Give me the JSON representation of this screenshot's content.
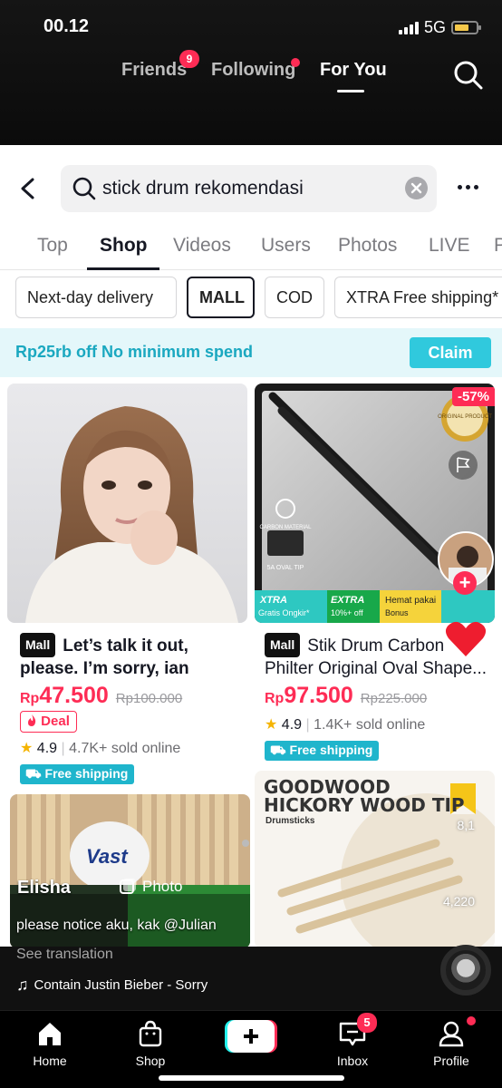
{
  "status_bar": {
    "time": "00.12",
    "network": "5G"
  },
  "tiktok_nav": {
    "friends": {
      "label": "Friends",
      "badge": "9"
    },
    "following": {
      "label": "Following"
    },
    "for_you": {
      "label": "For You"
    }
  },
  "search": {
    "query": "stick drum rekomendasi"
  },
  "tabs": [
    "Top",
    "Shop",
    "Videos",
    "Users",
    "Photos",
    "LIVE",
    "P"
  ],
  "active_tab": "Shop",
  "filters": [
    "Next-day delivery",
    "MALL",
    "COD",
    "XTRA Free shipping*"
  ],
  "selected_filter": "MALL",
  "promo": {
    "text": "Rp25rb off No minimum spend",
    "button": "Claim"
  },
  "products": [
    {
      "tag": "Mall",
      "title": "Let’s talk it out, please. I’m sorry, ian",
      "currency": "Rp",
      "price": "47.500",
      "original_price": "Rp100.000",
      "deal": "Deal",
      "rating": "4.9",
      "sold": "4.7K+ sold online",
      "shipping": "Free shipping"
    },
    {
      "tag": "Mall",
      "title": "Stik Drum Carbon Philter Original Oval Shape...",
      "currency": "Rp",
      "price": "97.500",
      "original_price": "Rp225.000",
      "discount": "-57%",
      "rating": "4.9",
      "sold": "1.4K+ sold online",
      "shipping": "Free shipping",
      "image_badges": {
        "original": "ORIGINAL PRODUCT",
        "carbon": "CARBON MATERIAL",
        "oval": "5A OVAL TIP",
        "xtra": "XTRA",
        "xtra_sub": "Gratis Ongkir*",
        "extra": "EXTRA",
        "extra_sub": "10%+ off",
        "hemat": "Hemat pakai",
        "hemat_sub": "Bonus"
      }
    }
  ],
  "media_cards": [
    {
      "brand": "Vast",
      "author": "Elisha",
      "type": "Photo"
    },
    {
      "headline": "GOODWOOD HICKORY WOOD TIP",
      "sub": "Drumsticks",
      "likes": "8,1",
      "shares": "4,220"
    }
  ],
  "video": {
    "caption": "please notice aku, kak @Julian",
    "see_translation": "See translation",
    "music": "Contain Justin Bieber - Sorry"
  },
  "bottom_nav": {
    "home": "Home",
    "shop": "Shop",
    "inbox": "Inbox",
    "inbox_badge": "5",
    "profile": "Profile"
  },
  "colors": {
    "accent": "#fe2c55",
    "teal": "#1fb5cc"
  }
}
